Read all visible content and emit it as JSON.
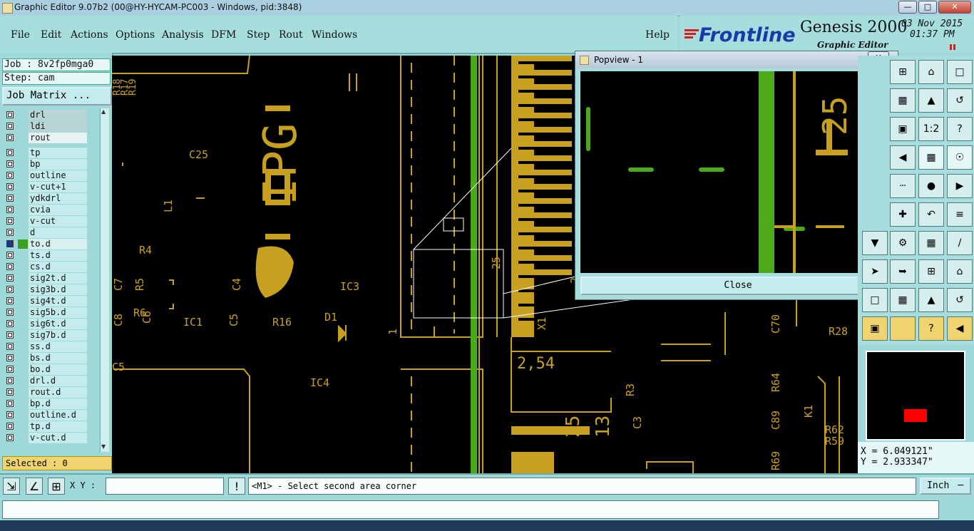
{
  "window": {
    "title": "Graphic Editor 9.07b2 (00@HY-HYCAM-PC003 - Windows, pid:3848)",
    "controls": [
      "minimize",
      "maximize",
      "close"
    ]
  },
  "menu": {
    "items": [
      "File",
      "Edit",
      "Actions",
      "Options",
      "Analysis",
      "DFM",
      "Step",
      "Rout",
      "Windows"
    ],
    "help": "Help"
  },
  "brand": {
    "logo_text": "Frontline",
    "product": "Genesis 2000",
    "subtitle": "Graphic Editor",
    "date": "03 Nov 2015",
    "time": "01:37 PM"
  },
  "left_panel": {
    "job_label": "Job : 8v2fp0mga0",
    "step_label": "Step: cam",
    "job_matrix_button": "Job Matrix ...",
    "layers_top": [
      "drl",
      "ldi",
      "rout"
    ],
    "layers": [
      "tp",
      "bp",
      "outline",
      "v-cut+1",
      "ydkdrl",
      "cvia",
      "v-cut",
      "d",
      "to.d",
      "ts.d",
      "cs.d",
      "sig2t.d",
      "sig3b.d",
      "sig4t.d",
      "sig5b.d",
      "sig6t.d",
      "sig7b.d",
      "ss.d",
      "bs.d",
      "bo.d",
      "drl.d",
      "rout.d",
      "bp.d",
      "outline.d",
      "tp.d",
      "v-cut.d"
    ],
    "active_layer": "to.d",
    "selected_label": "Selected : 0"
  },
  "canvas": {
    "labels": [
      "R18",
      "R17",
      "R19",
      "C25",
      "L1",
      "R4",
      "IPG",
      "C4",
      "C7",
      "R5",
      "R6",
      "C8",
      "C6",
      "IC1",
      "C5",
      "R16",
      "D1",
      "IC3",
      "1",
      "IC4",
      "C5",
      "2,54",
      "25",
      "13",
      "X1",
      "R3",
      "C3",
      "C70",
      "R28",
      "R64",
      "C89",
      "K1",
      "R62",
      "R59",
      "R69",
      "2",
      "25"
    ],
    "colors": {
      "copper": "#c8a020",
      "green": "#4caa1a",
      "background": "#000000"
    }
  },
  "popview": {
    "title": "Popview - 1",
    "close_button": "Close",
    "labels": [
      "25"
    ]
  },
  "tools": {
    "icons": [
      "zoom-in-icon",
      "home-icon",
      "window-icon",
      "zoom-box-icon",
      "pan-up-icon",
      "redraw-icon",
      "fit-icon",
      "scale-icon",
      "help-icon",
      "pan-left-icon",
      "grid-icon",
      "net-icon",
      "measure-icon",
      "pad-icon",
      "pan-right-icon",
      "snap-icon",
      "arc-icon",
      "text-icon",
      "pan-down-icon",
      "properties-icon",
      "layers-icon",
      "line-icon",
      "pointer-icon",
      "select-icon"
    ],
    "ratio_label": "1:2",
    "help_label": "?"
  },
  "coords": {
    "x": "X = 6.049121\"",
    "y": "Y = 2.933347\""
  },
  "bottom": {
    "xy_label": "X Y :",
    "xy_value": "",
    "prompt": "<M1> - Select second area corner",
    "units": "Inch"
  }
}
